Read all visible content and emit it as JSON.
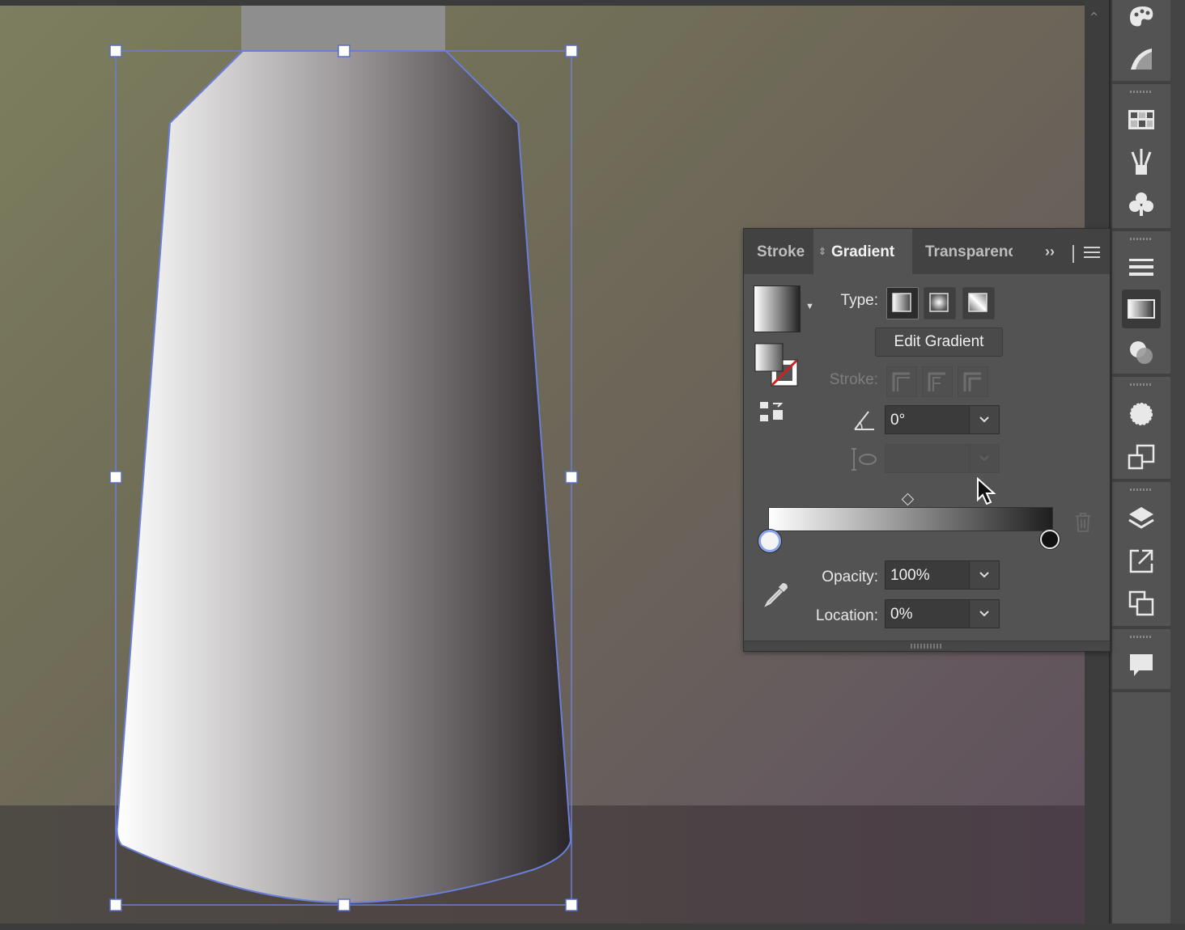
{
  "panel": {
    "tabs": [
      {
        "label": "Stroke"
      },
      {
        "label": "Gradient",
        "active": true
      },
      {
        "label": "Transparency"
      }
    ],
    "type_label": "Type:",
    "edit_gradient_label": "Edit Gradient",
    "stroke_label": "Stroke:",
    "angle_value": "0°",
    "aspect_value": "",
    "opacity_label": "Opacity:",
    "opacity_value": "100%",
    "location_label": "Location:",
    "location_value": "0%",
    "gradient_stops": [
      {
        "color": "#ffffff",
        "location": 0
      },
      {
        "color": "#1e1e1e",
        "location": 100
      }
    ]
  },
  "dock": {
    "icons": [
      "color-guide-icon",
      "gradient-swatch-icon",
      "swatches-icon",
      "brushes-icon",
      "symbols-icon",
      "stroke-icon",
      "gradient-icon",
      "transparency-icon",
      "appearance-icon",
      "graphic-styles-icon",
      "layers-icon",
      "export-icon",
      "artboards-icon",
      "comments-icon"
    ]
  },
  "colors": {
    "accent_selection": "#6a7fd8",
    "panel_bg": "#535353"
  }
}
